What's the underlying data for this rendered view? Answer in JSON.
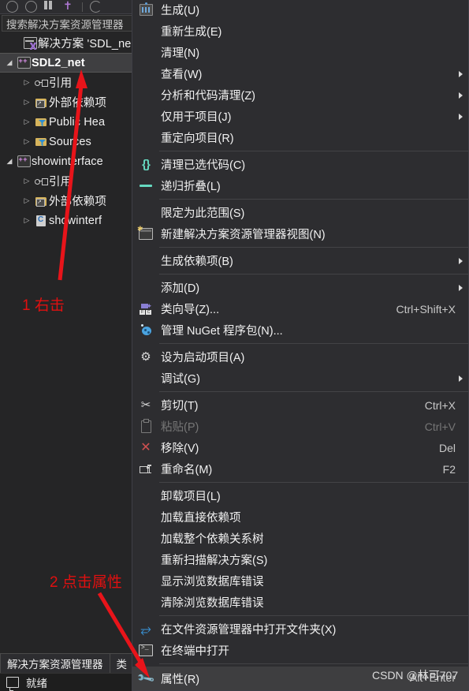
{
  "window": {
    "pane_title": "解决方案资源管理器",
    "status_text": "就绪"
  },
  "toolbar": {
    "icons": [
      "back-circle-icon",
      "forward-circle-icon",
      "home-columns-icon",
      "vs-logo-icon",
      "refresh-icon"
    ]
  },
  "search": {
    "placeholder": "搜索解决方案资源管理器",
    "value": "搜索解决方案资源管理器"
  },
  "tree": {
    "items": [
      {
        "label": "解决方案 'SDL_ne",
        "icon": "solution-icon",
        "indent": 0,
        "twisty": "none",
        "selected": false,
        "bold": false
      },
      {
        "label": "SDL2_net",
        "icon": "project-icon",
        "indent": 0,
        "twisty": "open",
        "selected": true,
        "bold": true
      },
      {
        "label": "引用",
        "icon": "references-icon",
        "indent": 1,
        "twisty": "closed",
        "selected": false,
        "bold": false
      },
      {
        "label": "外部依赖项",
        "icon": "external-dependencies-icon",
        "indent": 1,
        "twisty": "closed",
        "selected": false,
        "bold": false
      },
      {
        "label": "Public Hea",
        "icon": "filter-folder-icon",
        "indent": 1,
        "twisty": "closed",
        "selected": false,
        "bold": false
      },
      {
        "label": "Sources",
        "icon": "filter-folder-icon",
        "indent": 1,
        "twisty": "closed",
        "selected": false,
        "bold": false
      },
      {
        "label": "showinterface",
        "icon": "project-icon",
        "indent": 0,
        "twisty": "open",
        "selected": false,
        "bold": false
      },
      {
        "label": "引用",
        "icon": "references-icon",
        "indent": 1,
        "twisty": "closed",
        "selected": false,
        "bold": false
      },
      {
        "label": "外部依赖项",
        "icon": "external-dependencies-icon",
        "indent": 1,
        "twisty": "closed",
        "selected": false,
        "bold": false
      },
      {
        "label": "showinterf",
        "icon": "c-file-icon",
        "indent": 1,
        "twisty": "closed",
        "selected": false,
        "bold": false
      }
    ]
  },
  "tabs": [
    {
      "label": "解决方案资源管理器"
    },
    {
      "label": "类"
    }
  ],
  "context_menu": {
    "items": [
      {
        "type": "item",
        "label": "生成(U)",
        "shortcut": "",
        "icon": "build-icon",
        "submenu": false,
        "disabled": false,
        "highlight": false
      },
      {
        "type": "item",
        "label": "重新生成(E)",
        "shortcut": "",
        "icon": "",
        "submenu": false,
        "disabled": false,
        "highlight": false
      },
      {
        "type": "item",
        "label": "清理(N)",
        "shortcut": "",
        "icon": "",
        "submenu": false,
        "disabled": false,
        "highlight": false
      },
      {
        "type": "item",
        "label": "查看(W)",
        "shortcut": "",
        "icon": "",
        "submenu": true,
        "disabled": false,
        "highlight": false
      },
      {
        "type": "item",
        "label": "分析和代码清理(Z)",
        "shortcut": "",
        "icon": "",
        "submenu": true,
        "disabled": false,
        "highlight": false
      },
      {
        "type": "item",
        "label": "仅用于项目(J)",
        "shortcut": "",
        "icon": "",
        "submenu": true,
        "disabled": false,
        "highlight": false
      },
      {
        "type": "item",
        "label": "重定向项目(R)",
        "shortcut": "",
        "icon": "",
        "submenu": false,
        "disabled": false,
        "highlight": false
      },
      {
        "type": "separator"
      },
      {
        "type": "item",
        "label": "清理已选代码(C)",
        "shortcut": "",
        "icon": "braces-icon",
        "submenu": false,
        "disabled": false,
        "highlight": false
      },
      {
        "type": "item",
        "label": "递归折叠(L)",
        "shortcut": "",
        "icon": "collapse-icon",
        "submenu": false,
        "disabled": false,
        "highlight": false
      },
      {
        "type": "separator"
      },
      {
        "type": "item",
        "label": "限定为此范围(S)",
        "shortcut": "",
        "icon": "",
        "submenu": false,
        "disabled": false,
        "highlight": false
      },
      {
        "type": "item",
        "label": "新建解决方案资源管理器视图(N)",
        "shortcut": "",
        "icon": "new-view-icon",
        "submenu": false,
        "disabled": false,
        "highlight": false
      },
      {
        "type": "separator"
      },
      {
        "type": "item",
        "label": "生成依赖项(B)",
        "shortcut": "",
        "icon": "",
        "submenu": true,
        "disabled": false,
        "highlight": false
      },
      {
        "type": "separator"
      },
      {
        "type": "item",
        "label": "添加(D)",
        "shortcut": "",
        "icon": "",
        "submenu": true,
        "disabled": false,
        "highlight": false
      },
      {
        "type": "item",
        "label": "类向导(Z)...",
        "shortcut": "Ctrl+Shift+X",
        "icon": "class-wizard-icon",
        "submenu": false,
        "disabled": false,
        "highlight": false
      },
      {
        "type": "item",
        "label": "管理 NuGet 程序包(N)...",
        "shortcut": "",
        "icon": "nuget-icon",
        "submenu": false,
        "disabled": false,
        "highlight": false
      },
      {
        "type": "separator"
      },
      {
        "type": "item",
        "label": "设为启动项目(A)",
        "shortcut": "",
        "icon": "gear-icon",
        "submenu": false,
        "disabled": false,
        "highlight": false
      },
      {
        "type": "item",
        "label": "调试(G)",
        "shortcut": "",
        "icon": "",
        "submenu": true,
        "disabled": false,
        "highlight": false
      },
      {
        "type": "separator"
      },
      {
        "type": "item",
        "label": "剪切(T)",
        "shortcut": "Ctrl+X",
        "icon": "cut-icon",
        "submenu": false,
        "disabled": false,
        "highlight": false
      },
      {
        "type": "item",
        "label": "粘贴(P)",
        "shortcut": "Ctrl+V",
        "icon": "paste-icon",
        "submenu": false,
        "disabled": true,
        "highlight": false
      },
      {
        "type": "item",
        "label": "移除(V)",
        "shortcut": "Del",
        "icon": "remove-icon",
        "submenu": false,
        "disabled": false,
        "highlight": false
      },
      {
        "type": "item",
        "label": "重命名(M)",
        "shortcut": "F2",
        "icon": "rename-icon",
        "submenu": false,
        "disabled": false,
        "highlight": false
      },
      {
        "type": "separator"
      },
      {
        "type": "item",
        "label": "卸载项目(L)",
        "shortcut": "",
        "icon": "",
        "submenu": false,
        "disabled": false,
        "highlight": false
      },
      {
        "type": "item",
        "label": "加载直接依赖项",
        "shortcut": "",
        "icon": "",
        "submenu": false,
        "disabled": false,
        "highlight": false
      },
      {
        "type": "item",
        "label": "加载整个依赖关系树",
        "shortcut": "",
        "icon": "",
        "submenu": false,
        "disabled": false,
        "highlight": false
      },
      {
        "type": "item",
        "label": "重新扫描解决方案(S)",
        "shortcut": "",
        "icon": "",
        "submenu": false,
        "disabled": false,
        "highlight": false
      },
      {
        "type": "item",
        "label": "显示浏览数据库错误",
        "shortcut": "",
        "icon": "",
        "submenu": false,
        "disabled": false,
        "highlight": false
      },
      {
        "type": "item",
        "label": "清除浏览数据库错误",
        "shortcut": "",
        "icon": "",
        "submenu": false,
        "disabled": false,
        "highlight": false
      },
      {
        "type": "separator"
      },
      {
        "type": "item",
        "label": "在文件资源管理器中打开文件夹(X)",
        "shortcut": "",
        "icon": "open-folder-icon",
        "submenu": false,
        "disabled": false,
        "highlight": false
      },
      {
        "type": "item",
        "label": "在终端中打开",
        "shortcut": "",
        "icon": "terminal-icon",
        "submenu": false,
        "disabled": false,
        "highlight": false
      },
      {
        "type": "separator"
      },
      {
        "type": "item",
        "label": "属性(R)",
        "shortcut": "Alt+Enter",
        "icon": "wrench-icon",
        "submenu": false,
        "disabled": false,
        "highlight": true
      }
    ]
  },
  "annotations": [
    {
      "text": "1 右击",
      "color": "#e01010"
    },
    {
      "text": "2 点击属性",
      "color": "#e01010"
    }
  ],
  "watermark": {
    "text": "CSDN @林可707"
  }
}
